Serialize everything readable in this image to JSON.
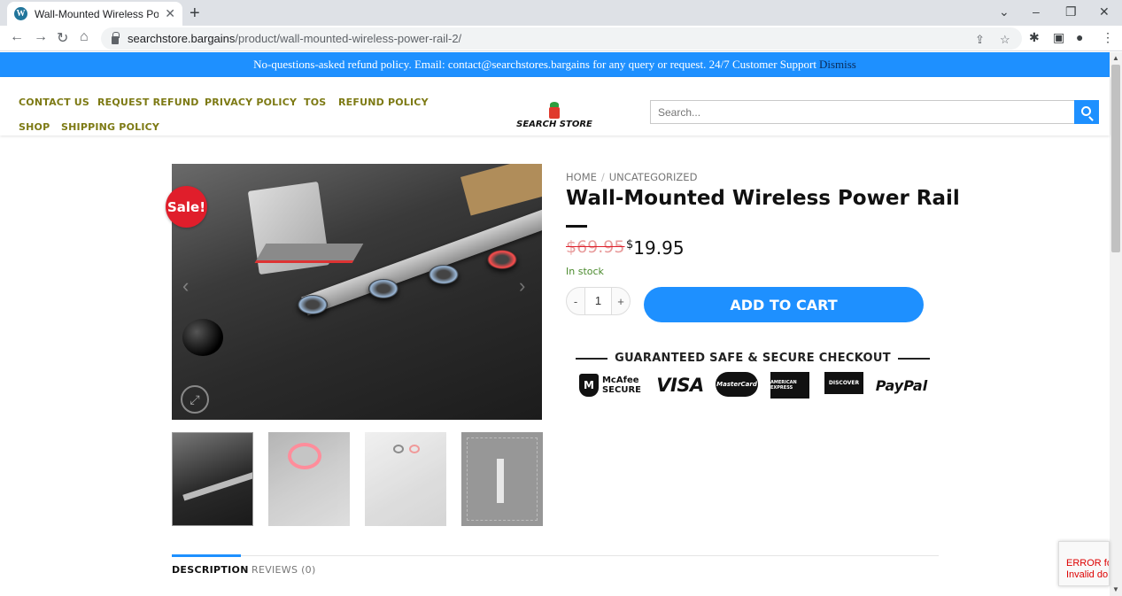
{
  "browser": {
    "tab_title": "Wall-Mounted Wireless Power Ra",
    "url_host": "searchstore.bargains",
    "url_path": "/product/wall-mounted-wireless-power-rail-2/"
  },
  "notice": {
    "text": "No-questions-asked refund policy. Email: contact@searchstores.bargains for any query or request. 24/7 Customer Support",
    "dismiss": "Dismiss"
  },
  "header": {
    "nav": [
      "CONTACT US",
      "REQUEST REFUND",
      "PRIVACY POLICY",
      "TOS",
      "REFUND POLICY",
      "SHOP",
      "SHIPPING POLICY"
    ],
    "logo_text": "SEARCH STORE",
    "search_placeholder": "Search..."
  },
  "product": {
    "sale_badge": "Sale!",
    "breadcrumb": [
      "HOME",
      "UNCATEGORIZED"
    ],
    "title": "Wall-Mounted Wireless Power Rail",
    "currency": "$",
    "old_price": "69.95",
    "new_price": "19.95",
    "stock": "In stock",
    "qty_minus": "-",
    "quantity": "1",
    "qty_plus": "+",
    "add_to_cart": "ADD TO CART"
  },
  "secure": {
    "heading": "GUARANTEED SAFE & SECURE CHECKOUT",
    "logos": {
      "mcafee_line1": "McAfee",
      "mcafee_line2": "SECURE",
      "visa": "VISA",
      "mastercard": "MasterCard",
      "amex": "AMERICAN EXPRESS",
      "discover": "DISCOVER",
      "paypal": "PayPal"
    }
  },
  "tabs": {
    "description": "DESCRIPTION",
    "reviews": "REVIEWS (0)"
  },
  "recaptcha": {
    "line1": "ERROR fo",
    "line2": "Invalid do"
  },
  "colors": {
    "accent": "#1e90ff",
    "nav_link": "#7d7a14",
    "sale": "#e01e2b",
    "stock": "#4a8a2c"
  }
}
